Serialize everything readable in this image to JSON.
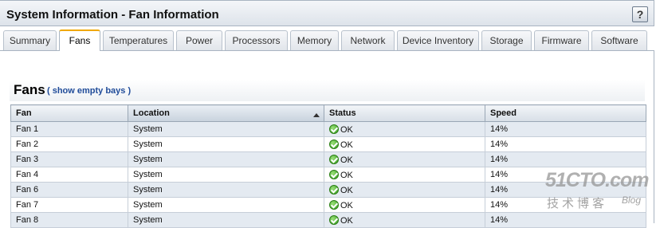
{
  "window": {
    "title": "System Information - Fan Information",
    "help_label": "?"
  },
  "tabs": [
    {
      "label": "Summary",
      "active": false
    },
    {
      "label": "Fans",
      "active": true
    },
    {
      "label": "Temperatures",
      "active": false
    },
    {
      "label": "Power",
      "active": false
    },
    {
      "label": "Processors",
      "active": false
    },
    {
      "label": "Memory",
      "active": false
    },
    {
      "label": "Network",
      "active": false
    },
    {
      "label": "Device Inventory",
      "active": false
    },
    {
      "label": "Storage",
      "active": false
    },
    {
      "label": "Firmware",
      "active": false
    },
    {
      "label": "Software",
      "active": false
    }
  ],
  "section": {
    "title": "Fans",
    "link_text": "( show empty bays )"
  },
  "table": {
    "columns": [
      "Fan",
      "Location",
      "Status",
      "Speed"
    ],
    "sorted_column": "Location",
    "rows": [
      {
        "fan": "Fan 1",
        "location": "System",
        "status": "OK",
        "speed": "14%"
      },
      {
        "fan": "Fan 2",
        "location": "System",
        "status": "OK",
        "speed": "14%"
      },
      {
        "fan": "Fan 3",
        "location": "System",
        "status": "OK",
        "speed": "14%"
      },
      {
        "fan": "Fan 4",
        "location": "System",
        "status": "OK",
        "speed": "14%"
      },
      {
        "fan": "Fan 6",
        "location": "System",
        "status": "OK",
        "speed": "14%"
      },
      {
        "fan": "Fan 7",
        "location": "System",
        "status": "OK",
        "speed": "14%"
      },
      {
        "fan": "Fan 8",
        "location": "System",
        "status": "OK",
        "speed": "14%"
      }
    ]
  },
  "watermark": {
    "main": "51CTO.com",
    "sub": "技术博客",
    "blog": "Blog"
  },
  "colors": {
    "active_tab_accent": "#f0a800",
    "link": "#1f4b99",
    "status_ok": "#2f9a18"
  },
  "icons": {
    "status_ok": "ok-check-icon",
    "sort": "sort-ascending-icon",
    "help": "help-icon"
  }
}
